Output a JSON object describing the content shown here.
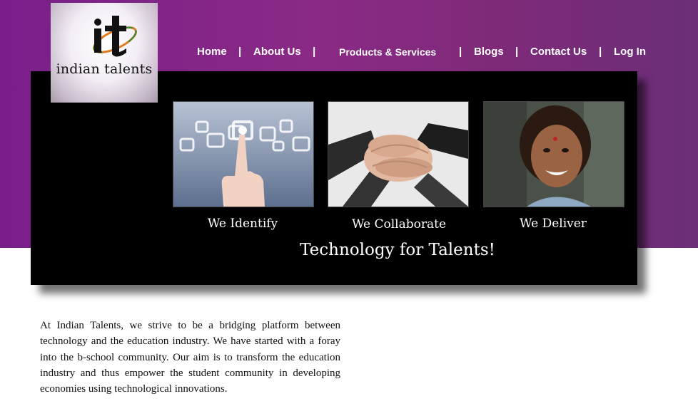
{
  "logo": {
    "mark": "it",
    "text": "indian talents"
  },
  "nav": {
    "items": [
      "Home",
      "About Us",
      "Products & Services",
      "Blogs",
      "Contact Us",
      "Log In"
    ],
    "separator": "|"
  },
  "banner": {
    "tiles": [
      {
        "image": "touchscreen-hand-image",
        "caption": "We Identify"
      },
      {
        "image": "team-hands-image",
        "caption": "We Collaborate"
      },
      {
        "image": "smiling-girl-image",
        "caption": "We Deliver"
      }
    ],
    "tagline": "Technology for Talents!"
  },
  "intro": {
    "text": "At Indian Talents, we strive to be a bridging platform between technology and the education industry. We have started with a foray into the b-school community. Our aim is to transform the education industry and thus empower the student community in developing economies using technological innovations."
  },
  "colors": {
    "header_purple": "#7a1f8a",
    "banner_black": "#000000",
    "text": "#111111"
  }
}
